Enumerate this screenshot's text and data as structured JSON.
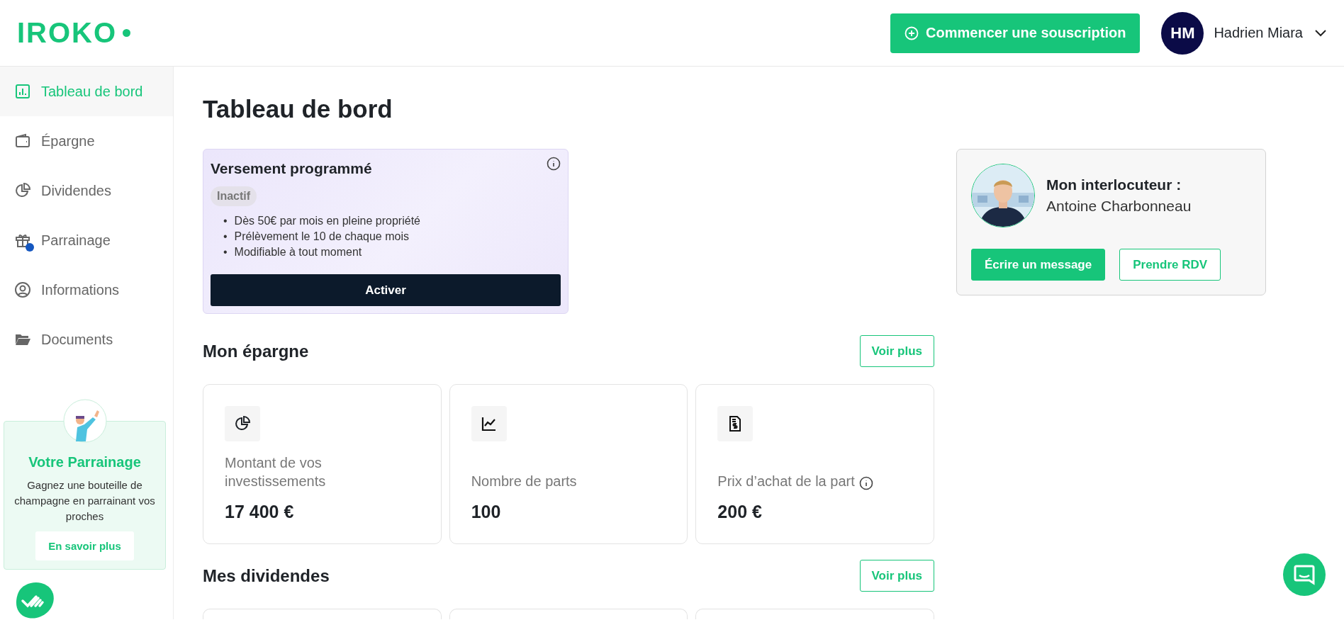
{
  "header": {
    "logo": "IROKO",
    "cta": "Commencer une souscription",
    "user": {
      "initials": "HM",
      "name": "Hadrien Miara"
    }
  },
  "sidebar": {
    "items": [
      {
        "label": "Tableau de bord",
        "selected": true,
        "notification": false
      },
      {
        "label": "Épargne",
        "selected": false,
        "notification": false
      },
      {
        "label": "Dividendes",
        "selected": false,
        "notification": false
      },
      {
        "label": "Parrainage",
        "selected": false,
        "notification": true
      },
      {
        "label": "Informations",
        "selected": false,
        "notification": false
      },
      {
        "label": "Documents",
        "selected": false,
        "notification": false
      }
    ],
    "referral": {
      "title": "Votre Parrainage",
      "text": "Gagnez une bouteille de champagne en parrainant vos proches",
      "button": "En savoir plus"
    }
  },
  "page_title": "Tableau de bord",
  "scheduled_payment": {
    "title": "Versement programmé",
    "status": "Inactif",
    "bullet_marker": "•",
    "bullets": [
      "Dès 50€ par mois en pleine propriété",
      "Prélèvement le 10 de chaque mois",
      "Modifiable à tout moment"
    ],
    "button": "Activer"
  },
  "advisor": {
    "label": "Mon interlocuteur :",
    "name": "Antoine Charbonneau",
    "buttons": [
      {
        "label": "Écrire un message",
        "kind": "primary"
      },
      {
        "label": "Prendre RDV",
        "kind": "outline"
      }
    ]
  },
  "savings": {
    "title": "Mon épargne",
    "more": "Voir plus",
    "stats": [
      {
        "label": "Montant de vos investissements",
        "value": "17 400 €",
        "info": false
      },
      {
        "label": "Nombre de parts",
        "value": "100",
        "info": false
      },
      {
        "label": "Prix d’achat de la part",
        "value": "200 €",
        "info": true
      }
    ]
  },
  "dividends": {
    "title": "Mes dividendes",
    "more": "Voir plus"
  }
}
